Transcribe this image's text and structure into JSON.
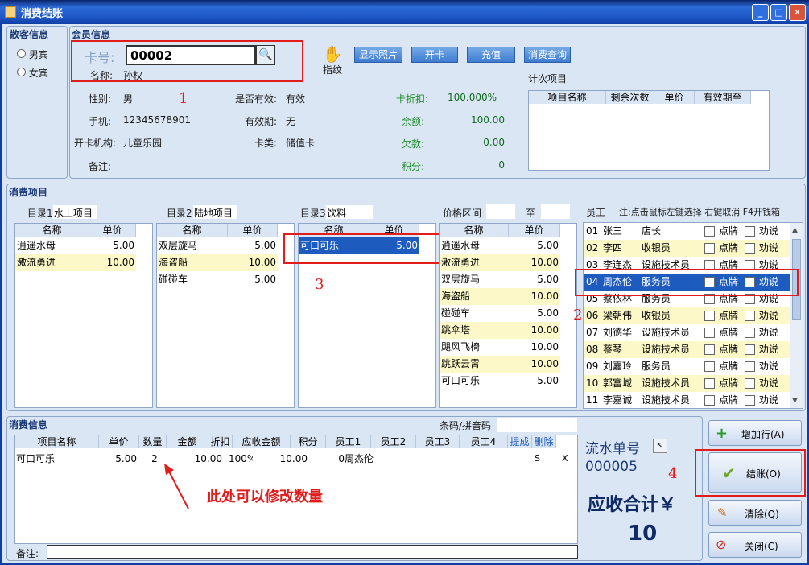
{
  "window": {
    "title": "消费结账",
    "min": "_",
    "max": "□",
    "close": "✕"
  },
  "guest": {
    "title": "散客信息",
    "male": "男宾",
    "female": "女宾"
  },
  "member": {
    "title": "会员信息",
    "card_label": "卡号:",
    "card_value": "00002",
    "name_label": "名称:",
    "name_value": "孙权",
    "fingerprint": "指纹",
    "btn_photo": "显示照片",
    "btn_open": "开卡",
    "btn_recharge": "充值",
    "btn_query": "消费查询",
    "gender_label": "性别:",
    "gender_value": "男",
    "phone_label": "手机:",
    "phone_value": "12345678901",
    "org_label": "开卡机构:",
    "org_value": "儿童乐园",
    "remark_label": "备注:",
    "valid_label": "是否有效:",
    "valid_value": "有效",
    "expire_label": "有效期:",
    "expire_value": "无",
    "cardtype_label": "卡类:",
    "cardtype_value": "储值卡",
    "discount_label": "卡折扣:",
    "discount_value": "100.000%",
    "balance_label": "余额:",
    "balance_value": "100.00",
    "debt_label": "欠款:",
    "debt_value": "0.00",
    "points_label": "积分:",
    "points_value": "0",
    "count_items_title": "计次项目",
    "count_headers": [
      "项目名称",
      "剩余次数",
      "单价",
      "有效期至"
    ]
  },
  "consume_items": {
    "title": "消费项目",
    "cat1_label": "目录1",
    "cat1_value": "水上项目",
    "cat2_label": "目录2",
    "cat2_value": "陆地项目",
    "cat3_label": "目录3",
    "cat3_value": "饮料",
    "price_range_label": "价格区间",
    "price_to": "至",
    "col_name": "名称",
    "col_price": "单价",
    "list1": [
      {
        "n": "逍遥水母",
        "p": "5.00"
      },
      {
        "n": "激流勇进",
        "p": "10.00"
      }
    ],
    "list2": [
      {
        "n": "双层旋马",
        "p": "5.00"
      },
      {
        "n": "海盗船",
        "p": "10.00"
      },
      {
        "n": "碰碰车",
        "p": "5.00"
      }
    ],
    "list3": [
      {
        "n": "可口可乐",
        "p": "5.00"
      }
    ],
    "list4": [
      {
        "n": "逍遥水母",
        "p": "5.00"
      },
      {
        "n": "激流勇进",
        "p": "10.00"
      },
      {
        "n": "双层旋马",
        "p": "5.00"
      },
      {
        "n": "海盗船",
        "p": "10.00"
      },
      {
        "n": "碰碰车",
        "p": "5.00"
      },
      {
        "n": "跳伞塔",
        "p": "10.00"
      },
      {
        "n": "飓风飞椅",
        "p": "10.00"
      },
      {
        "n": "跳跃云霄",
        "p": "10.00"
      },
      {
        "n": "可口可乐",
        "p": "5.00"
      }
    ],
    "staff_label": "员工",
    "staff_note": "注:点击鼠标左键选择 右键取消 F4开钱箱",
    "staff_tag1": "点牌",
    "staff_tag2": "劝说",
    "staff": [
      {
        "id": "01",
        "name": "张三",
        "role": "店长"
      },
      {
        "id": "02",
        "name": "李四",
        "role": "收银员"
      },
      {
        "id": "03",
        "name": "李连杰",
        "role": "设施技术员"
      },
      {
        "id": "04",
        "name": "周杰伦",
        "role": "服务员"
      },
      {
        "id": "05",
        "name": "蔡依林",
        "role": "服务员"
      },
      {
        "id": "06",
        "name": "梁朝伟",
        "role": "收银员"
      },
      {
        "id": "07",
        "name": "刘德华",
        "role": "设施技术员"
      },
      {
        "id": "08",
        "name": "蔡琴",
        "role": "设施技术员"
      },
      {
        "id": "09",
        "name": "刘嘉玲",
        "role": "服务员"
      },
      {
        "id": "10",
        "name": "郭富城",
        "role": "设施技术员"
      },
      {
        "id": "11",
        "name": "李嘉诚",
        "role": "设施技术员"
      }
    ]
  },
  "consume_info": {
    "title": "消费信息",
    "barcode_label": "条码/拼音码",
    "headers": [
      "项目名称",
      "单价",
      "数量",
      "金额",
      "折扣",
      "应收金额",
      "积分",
      "员工1",
      "员工2",
      "员工3",
      "员工4",
      "提成",
      "删除"
    ],
    "row": {
      "name": "可口可乐",
      "price": "5.00",
      "qty": "2",
      "amount": "10.00",
      "discount": "100%",
      "due": "10.00",
      "points": "0",
      "staff1": "周杰伦",
      "commission": "S",
      "delete": "X"
    },
    "annotation": "此处可以修改数量",
    "remark_label": "备注:"
  },
  "summary": {
    "serial_label": "流水单号",
    "serial_value": "000005",
    "total_label": "应收合计￥",
    "total_value": "10"
  },
  "actions": {
    "add_row": "增加行(A)",
    "checkout": "结账(O)",
    "clear": "清除(Q)",
    "close": "关闭(C)"
  },
  "markers": {
    "m1": "1",
    "m2": "2",
    "m3": "3",
    "m4": "4"
  }
}
